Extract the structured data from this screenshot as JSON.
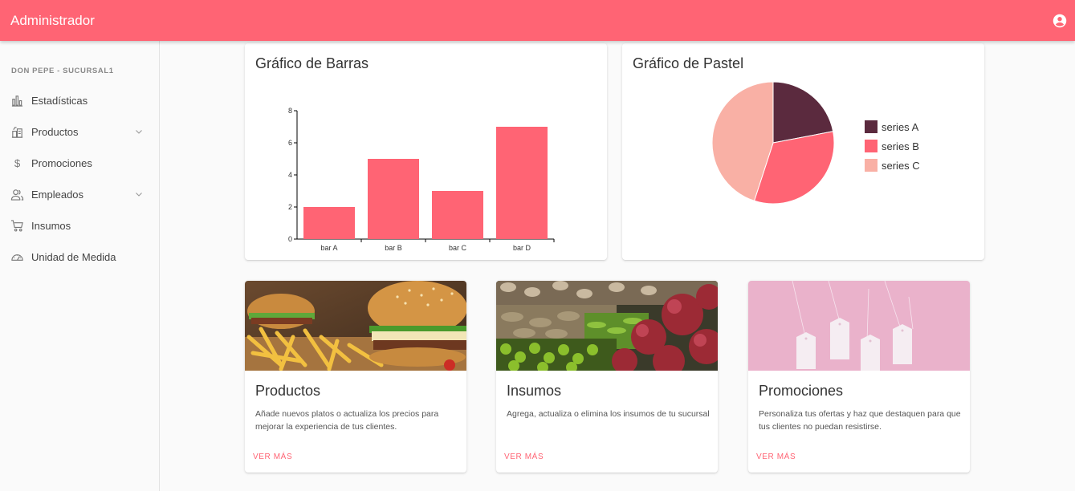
{
  "appbar": {
    "title": "Administrador",
    "account_icon": "account-circle-icon"
  },
  "sidebar": {
    "branch": "DON PEPE - SUCURSAL1",
    "items": [
      {
        "label": "Estadísticas",
        "icon": "bar-chart-icon",
        "expandable": false
      },
      {
        "label": "Productos",
        "icon": "store-icon",
        "expandable": true
      },
      {
        "label": "Promociones",
        "icon": "dollar-icon",
        "expandable": false
      },
      {
        "label": "Empleados",
        "icon": "people-icon",
        "expandable": true
      },
      {
        "label": "Insumos",
        "icon": "cart-icon",
        "expandable": false
      },
      {
        "label": "Unidad de Medida",
        "icon": "gauge-icon",
        "expandable": false
      }
    ]
  },
  "bar_card": {
    "title": "Gráfico de Barras"
  },
  "pie_card": {
    "title": "Gráfico de Pastel"
  },
  "chart_data": [
    {
      "type": "bar",
      "categories": [
        "bar A",
        "bar B",
        "bar C",
        "bar D"
      ],
      "values": [
        2,
        5,
        3,
        7
      ],
      "yticks": [
        0,
        2,
        4,
        6,
        8
      ],
      "ylim": [
        0,
        8
      ],
      "color": "#ff6474",
      "title": "Gráfico de Barras"
    },
    {
      "type": "pie",
      "labels": [
        "series A",
        "series B",
        "series C"
      ],
      "values": [
        22,
        33,
        45
      ],
      "colors": [
        "#5b2a3e",
        "#ff6474",
        "#f9b0a5"
      ],
      "legend": "right",
      "title": "Gráfico de Pastel"
    }
  ],
  "cards": [
    {
      "title": "Productos",
      "description": "Añade nuevos platos o actualiza los precios para mejorar la experiencia de tus clientes.",
      "action": "VER MÁS",
      "image": "burgers-and-fries-photo"
    },
    {
      "title": "Insumos",
      "description": "Agrega, actualiza o elimina los insumos de tu sucursal",
      "action": "VER MÁS",
      "image": "market-vegetables-photo"
    },
    {
      "title": "Promociones",
      "description": "Personaliza tus ofertas y haz que destaquen para que tus clientes no puedan resistirse.",
      "action": "VER MÁS",
      "image": "price-tags-photo"
    }
  ],
  "colors": {
    "primary": "#ff6474",
    "pie_dark": "#5b2a3e",
    "pie_light": "#f9b0a5"
  }
}
